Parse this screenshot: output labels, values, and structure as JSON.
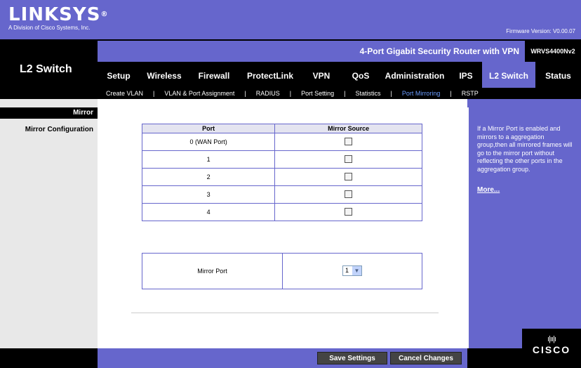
{
  "header": {
    "brand": "LINKSYS",
    "tagline": "A Division of Cisco Systems, Inc.",
    "firmware": "Firmware Version: V0.00.07",
    "product_name": "4-Port Gigabit Security Router with VPN",
    "model": "WRVS4400Nv2"
  },
  "section_title": "L2 Switch",
  "tabs": [
    "Setup",
    "Wireless",
    "Firewall",
    "ProtectLink",
    "VPN",
    "QoS",
    "Administration",
    "IPS",
    "L2 Switch",
    "Status"
  ],
  "subtabs": [
    "Create VLAN",
    "VLAN & Port Assignment",
    "RADIUS",
    "Port Setting",
    "Statistics",
    "Port Mirroring",
    "RSTP"
  ],
  "sidebar": {
    "heading": "Mirror",
    "item": "Mirror Configuration"
  },
  "table": {
    "headers": [
      "Port",
      "Mirror Source"
    ],
    "rows": [
      "0 (WAN Port)",
      "1",
      "2",
      "3",
      "4"
    ]
  },
  "mirror_port": {
    "label": "Mirror Port",
    "value": "1"
  },
  "help": {
    "text": "If a Mirror Port is enabled and mirrors to a aggregation group,then all mirrored frames will go to the mirror port without reflecting the other ports in the aggregation group.",
    "more": "More..."
  },
  "buttons": {
    "save": "Save Settings",
    "cancel": "Cancel Changes"
  },
  "footer_logo": {
    "name": "CISCO"
  }
}
